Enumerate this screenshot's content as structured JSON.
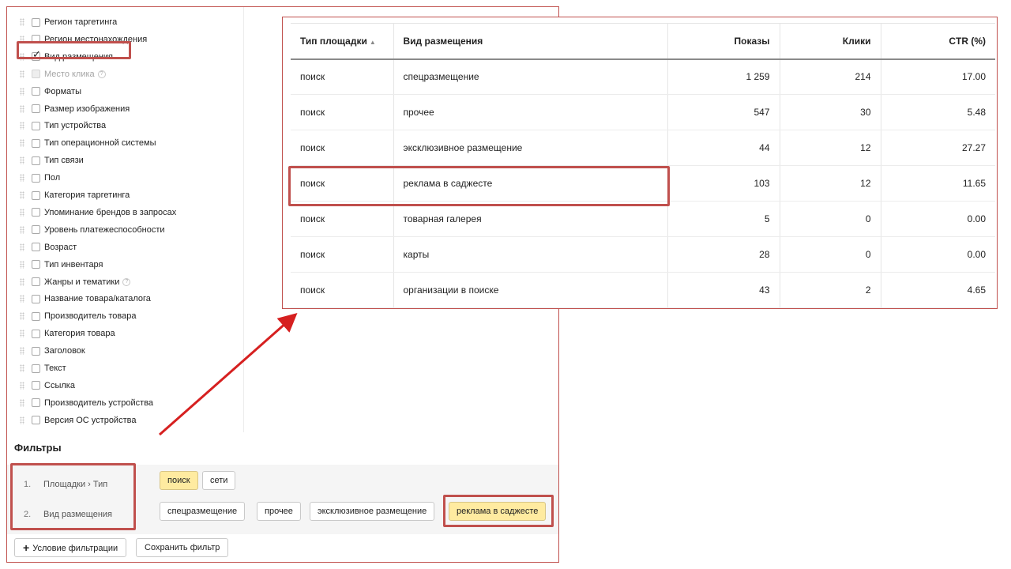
{
  "groupings": [
    {
      "label": "Регион таргетинга",
      "checked": false,
      "disabled": false,
      "help": false
    },
    {
      "label": "Регион местонахождения",
      "checked": false,
      "disabled": false,
      "help": false
    },
    {
      "label": "Вид размещения",
      "checked": true,
      "disabled": false,
      "help": false
    },
    {
      "label": "Место клика",
      "checked": false,
      "disabled": true,
      "help": true
    },
    {
      "label": "Форматы",
      "checked": false,
      "disabled": false,
      "help": false
    },
    {
      "label": "Размер изображения",
      "checked": false,
      "disabled": false,
      "help": false
    },
    {
      "label": "Тип устройства",
      "checked": false,
      "disabled": false,
      "help": false
    },
    {
      "label": "Тип операционной системы",
      "checked": false,
      "disabled": false,
      "help": false
    },
    {
      "label": "Тип связи",
      "checked": false,
      "disabled": false,
      "help": false
    },
    {
      "label": "Пол",
      "checked": false,
      "disabled": false,
      "help": false
    },
    {
      "label": "Категория таргетинга",
      "checked": false,
      "disabled": false,
      "help": false
    },
    {
      "label": "Упоминание брендов в запросах",
      "checked": false,
      "disabled": false,
      "help": false
    },
    {
      "label": "Уровень платежеспособности",
      "checked": false,
      "disabled": false,
      "help": false
    },
    {
      "label": "Возраст",
      "checked": false,
      "disabled": false,
      "help": false
    },
    {
      "label": "Тип инвентаря",
      "checked": false,
      "disabled": false,
      "help": false
    },
    {
      "label": "Жанры и тематики",
      "checked": false,
      "disabled": false,
      "help": true
    },
    {
      "label": "Название товара/каталога",
      "checked": false,
      "disabled": false,
      "help": false
    },
    {
      "label": "Производитель товара",
      "checked": false,
      "disabled": false,
      "help": false
    },
    {
      "label": "Категория товара",
      "checked": false,
      "disabled": false,
      "help": false
    },
    {
      "label": "Заголовок",
      "checked": false,
      "disabled": false,
      "help": false
    },
    {
      "label": "Текст",
      "checked": false,
      "disabled": false,
      "help": false
    },
    {
      "label": "Ссылка",
      "checked": false,
      "disabled": false,
      "help": false
    },
    {
      "label": "Производитель устройства",
      "checked": false,
      "disabled": false,
      "help": false
    },
    {
      "label": "Версия ОС устройства",
      "checked": false,
      "disabled": false,
      "help": false
    }
  ],
  "filters": {
    "title": "Фильтры",
    "rows": [
      {
        "num": "1.",
        "label": "Площадки › Тип",
        "chips": [
          {
            "label": "поиск",
            "selected": true
          },
          {
            "label": "сети",
            "selected": false
          }
        ]
      },
      {
        "num": "2.",
        "label": "Вид размещения",
        "chips": [
          {
            "label": "спецразмещение",
            "selected": false
          },
          {
            "label": "прочее",
            "selected": false
          },
          {
            "label": "эксклюзивное размещение",
            "selected": false
          },
          {
            "label": "реклама в саджесте",
            "selected": true
          }
        ]
      }
    ],
    "add_condition": "Условие фильтрации",
    "save_filter": "Сохранить фильтр"
  },
  "table": {
    "columns": [
      "Тип площадки",
      "Вид размещения",
      "Показы",
      "Клики",
      "CTR (%)"
    ],
    "sort_indicator": "▲",
    "rows": [
      [
        "поиск",
        "спецразмещение",
        "1 259",
        "214",
        "17.00"
      ],
      [
        "поиск",
        "прочее",
        "547",
        "30",
        "5.48"
      ],
      [
        "поиск",
        "эксклюзивное размещение",
        "44",
        "12",
        "27.27"
      ],
      [
        "поиск",
        "реклама в саджесте",
        "103",
        "12",
        "11.65"
      ],
      [
        "поиск",
        "товарная галерея",
        "5",
        "0",
        "0.00"
      ],
      [
        "поиск",
        "карты",
        "28",
        "0",
        "0.00"
      ],
      [
        "поиск",
        "организации в поиске",
        "43",
        "2",
        "4.65"
      ]
    ]
  },
  "colors": {
    "highlight": "#c0504d",
    "selected_chip": "#ffeba0",
    "arrow": "#d62020"
  }
}
